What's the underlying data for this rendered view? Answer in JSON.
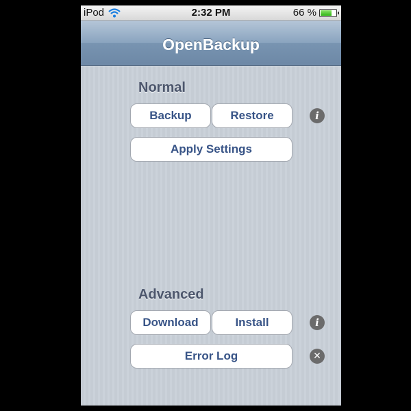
{
  "status_bar": {
    "carrier": "iPod",
    "time": "2:32 PM",
    "battery_percent_label": "66 %",
    "battery_level": 0.66
  },
  "nav": {
    "title": "OpenBackup"
  },
  "normal_section": {
    "header": "Normal",
    "backup_label": "Backup",
    "restore_label": "Restore",
    "apply_settings_label": "Apply Settings",
    "info_icon": "info-icon"
  },
  "advanced_section": {
    "header": "Advanced",
    "download_label": "Download",
    "install_label": "Install",
    "error_log_label": "Error Log",
    "info_icon": "info-icon",
    "close_icon": "close-icon"
  },
  "colors": {
    "nav_bar": "#7894b1",
    "button_text": "#385487",
    "section_header": "#4c566c",
    "background": "#c5ccd4"
  }
}
